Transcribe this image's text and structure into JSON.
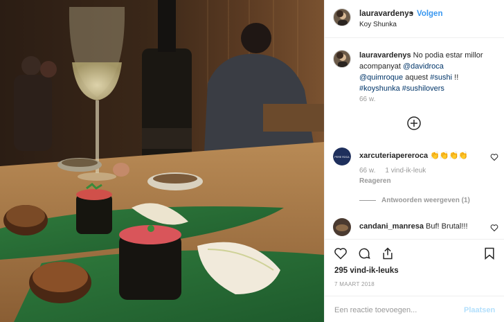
{
  "post": {
    "username": "lauravardenys",
    "follow_label": "Volgen",
    "dot": "•",
    "location": "Koy Shunka",
    "photo_name": "sushi-dinner-photo"
  },
  "caption": {
    "username": "lauravardenys",
    "text_1": " No podia estar millor acompanyat ",
    "mention_1": "@davidroca",
    "mention_2": "@quimroque",
    "text_2": " aquest ",
    "tag_1": "#sushi",
    "text_3": " !! ",
    "tag_2": "#koyshunka",
    "tag_3": "#sushilovers",
    "time": "66 w."
  },
  "load_more_icon": "plus-circle-icon",
  "comments": [
    {
      "username": "xarcuteriapereroca",
      "text": "👏👏👏👏",
      "avatar_text": "PERE ROCA",
      "time": "66 w.",
      "likes": "1 vind-ik-leuk",
      "reply": "Reageren"
    },
    {
      "username": "candani_manresa",
      "text": "Buf! Brutal!!!"
    }
  ],
  "view_replies": "Antwoorden weergeven (1)",
  "actions": {
    "icons": [
      "heart-icon",
      "comment-icon",
      "share-icon",
      "bookmark-icon"
    ],
    "likes": "295 vind-ik-leuks",
    "date": "7 MAART 2018"
  },
  "add_comment": {
    "placeholder": "Een reactie toevoegen...",
    "post_label": "Plaatsen"
  },
  "colors": {
    "link": "#3897f0",
    "mention": "#003569",
    "muted": "#999999",
    "post_disabled": "#b2dffc"
  }
}
